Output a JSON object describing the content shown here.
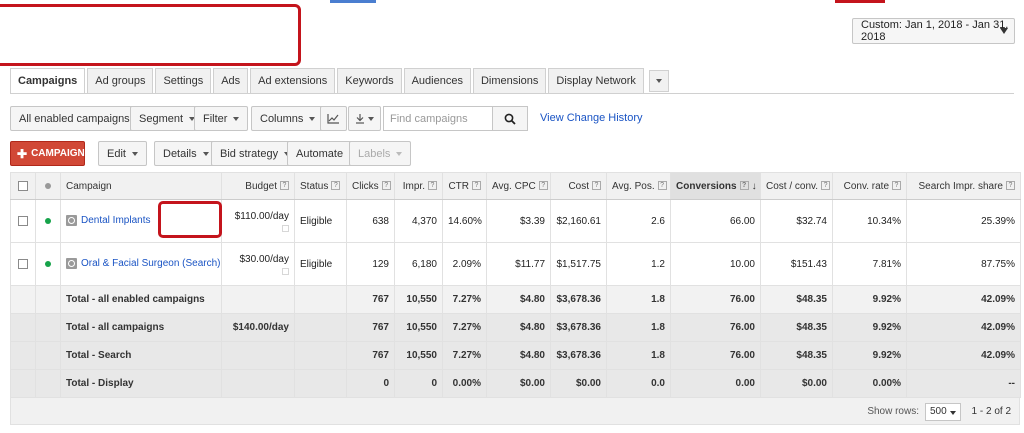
{
  "date_range": {
    "label": "Custom: Jan 1, 2018 - Jan 31, 2018"
  },
  "tabs": [
    {
      "label": "Campaigns",
      "active": true
    },
    {
      "label": "Ad groups"
    },
    {
      "label": "Settings"
    },
    {
      "label": "Ads"
    },
    {
      "label": "Ad extensions"
    },
    {
      "label": "Keywords"
    },
    {
      "label": "Audiences"
    },
    {
      "label": "Dimensions"
    },
    {
      "label": "Display Network"
    }
  ],
  "toolbar": {
    "filter_scope": "All enabled campaigns",
    "segment": "Segment",
    "filter": "Filter",
    "columns": "Columns",
    "search_placeholder": "Find campaigns",
    "view_change_history": "View Change History"
  },
  "actions": {
    "add_campaign": "CAMPAIGN",
    "edit": "Edit",
    "details": "Details",
    "bid_strategy": "Bid strategy",
    "automate": "Automate",
    "labels": "Labels"
  },
  "columns": {
    "campaign": "Campaign",
    "budget": "Budget",
    "status": "Status",
    "clicks": "Clicks",
    "impr": "Impr.",
    "ctr": "CTR",
    "avg_cpc": "Avg. CPC",
    "cost": "Cost",
    "avg_pos": "Avg. Pos.",
    "conversions": "Conversions",
    "cost_conv": "Cost / conv.",
    "conv_rate": "Conv. rate",
    "search_impr_share": "Search Impr. share"
  },
  "rows": [
    {
      "campaign": "Dental Implants",
      "budget": "$110.00/day",
      "status": "Eligible",
      "clicks": "638",
      "impr": "4,370",
      "ctr": "14.60%",
      "avg_cpc": "$3.39",
      "cost": "$2,160.61",
      "avg_pos": "2.6",
      "conversions": "66.00",
      "cost_conv": "$32.74",
      "conv_rate": "10.34%",
      "search_impr_share": "25.39%"
    },
    {
      "campaign": "Oral & Facial Surgeon (Search)",
      "budget": "$30.00/day",
      "status": "Eligible",
      "clicks": "129",
      "impr": "6,180",
      "ctr": "2.09%",
      "avg_cpc": "$11.77",
      "cost": "$1,517.75",
      "avg_pos": "1.2",
      "conversions": "10.00",
      "cost_conv": "$151.43",
      "conv_rate": "7.81%",
      "search_impr_share": "87.75%"
    }
  ],
  "totals": [
    {
      "label": "Total - all enabled campaigns",
      "budget": "",
      "clicks": "767",
      "impr": "10,550",
      "ctr": "7.27%",
      "avg_cpc": "$4.80",
      "cost": "$3,678.36",
      "avg_pos": "1.8",
      "conversions": "76.00",
      "cost_conv": "$48.35",
      "conv_rate": "9.92%",
      "search_impr_share": "42.09%"
    },
    {
      "label": "Total - all campaigns",
      "budget": "$140.00/day",
      "clicks": "767",
      "impr": "10,550",
      "ctr": "7.27%",
      "avg_cpc": "$4.80",
      "cost": "$3,678.36",
      "avg_pos": "1.8",
      "conversions": "76.00",
      "cost_conv": "$48.35",
      "conv_rate": "9.92%",
      "search_impr_share": "42.09%"
    },
    {
      "label": "Total - Search",
      "budget": "",
      "clicks": "767",
      "impr": "10,550",
      "ctr": "7.27%",
      "avg_cpc": "$4.80",
      "cost": "$3,678.36",
      "avg_pos": "1.8",
      "conversions": "76.00",
      "cost_conv": "$48.35",
      "conv_rate": "9.92%",
      "search_impr_share": "42.09%"
    },
    {
      "label": "Total - Display",
      "budget": "",
      "clicks": "0",
      "impr": "0",
      "ctr": "0.00%",
      "avg_cpc": "$0.00",
      "cost": "$0.00",
      "avg_pos": "0.0",
      "conversions": "0.00",
      "cost_conv": "$0.00",
      "conv_rate": "0.00%",
      "search_impr_share": "--"
    }
  ],
  "footer": {
    "show_rows_label": "Show rows:",
    "rows_value": "500",
    "range": "1 - 2 of 2"
  },
  "colors": {
    "accent_red": "#d14836",
    "highlight_box": "#c4141c",
    "link_blue": "#1a54c4",
    "status_green": "#16a34a"
  }
}
